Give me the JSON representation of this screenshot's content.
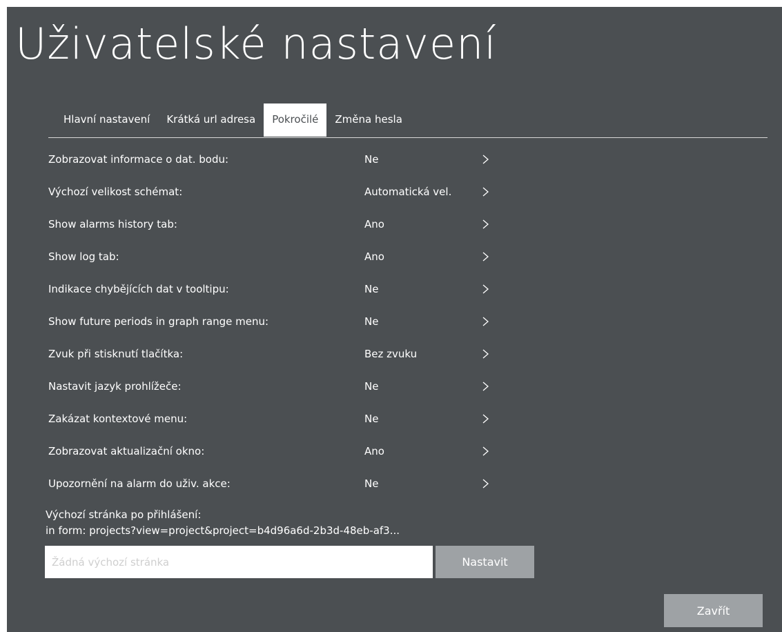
{
  "title": "Uživatelské nastavení",
  "tabs": [
    {
      "label": "Hlavní nastavení",
      "active": false
    },
    {
      "label": "Krátká url adresa",
      "active": false
    },
    {
      "label": "Pokročilé",
      "active": true
    },
    {
      "label": "Změna hesla",
      "active": false
    }
  ],
  "settings": [
    {
      "label": "Zobrazovat informace o dat. bodu:",
      "value": "Ne"
    },
    {
      "label": "Výchozí velikost schémat:",
      "value": "Automatická vel."
    },
    {
      "label": "Show alarms history tab:",
      "value": "Ano"
    },
    {
      "label": "Show log tab:",
      "value": "Ano"
    },
    {
      "label": "Indikace chybějících dat v tooltipu:",
      "value": "Ne"
    },
    {
      "label": "Show future periods in graph range menu:",
      "value": "Ne"
    },
    {
      "label": "Zvuk při stisknutí tlačítka:",
      "value": "Bez zvuku"
    },
    {
      "label": "Nastavit jazyk prohlížeče:",
      "value": "Ne"
    },
    {
      "label": "Zakázat kontextové menu:",
      "value": "Ne"
    },
    {
      "label": "Zobrazovat aktualizační okno:",
      "value": "Ano"
    },
    {
      "label": "Upozornění na alarm do uživ. akce:",
      "value": "Ne"
    }
  ],
  "default_page": {
    "label": "Výchozí stránka po přihlášení:",
    "hint": "in form: projects?view=project&project=b4d96a6d-2b3d-48eb-af3...",
    "placeholder": "Žádná výchozí stránka",
    "value": "",
    "set_button": "Nastavit"
  },
  "close_button": "Zavřít",
  "colors": {
    "background": "#4b4f52",
    "button": "#9ea2a5",
    "active_tab": "#ffffff"
  },
  "icons": {
    "row_arrow": "chevron-right-icon"
  }
}
